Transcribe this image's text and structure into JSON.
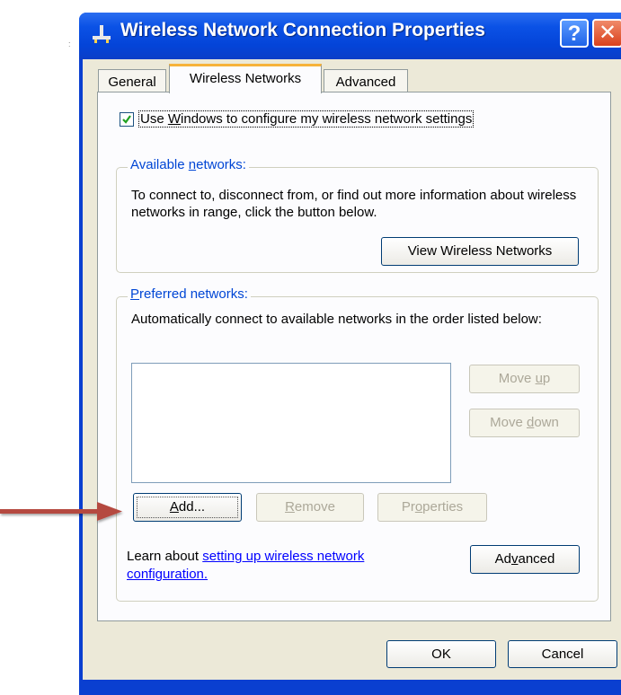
{
  "window": {
    "title": "Wireless Network Connection Properties",
    "help_label": "?",
    "close_label": "✕"
  },
  "tabs": [
    {
      "label": "General"
    },
    {
      "label": "Wireless Networks"
    },
    {
      "label": "Advanced"
    }
  ],
  "use_windows": {
    "label_pre": "Use ",
    "label_acc": "W",
    "label_post": "indows to configure my wireless network settings",
    "checked": true
  },
  "available": {
    "legend_pre": "Available ",
    "legend_acc": "n",
    "legend_post": "etworks:",
    "description": "To connect to, disconnect from, or find out more information about wireless networks in range, click the button below.",
    "view_button": "View Wireless Networks"
  },
  "preferred": {
    "legend_acc": "P",
    "legend_post": "referred networks:",
    "description": "Automatically connect to available networks in the order listed below:",
    "move_up_pre": "Move ",
    "move_up_acc": "u",
    "move_up_post": "p",
    "move_down_pre": "Move ",
    "move_down_acc": "d",
    "move_down_post": "own",
    "add_acc": "A",
    "add_post": "dd...",
    "remove_acc": "R",
    "remove_post": "emove",
    "properties_pre": "Pr",
    "properties_acc": "o",
    "properties_post": "perties",
    "learn_prefix": "Learn about ",
    "learn_link_line1": "setting up wireless network",
    "learn_link_line2": "configuration.",
    "advanced_pre": "Ad",
    "advanced_acc": "v",
    "advanced_post": "anced"
  },
  "footer": {
    "ok": "OK",
    "cancel": "Cancel"
  },
  "colors": {
    "titlebar": "#0a3ec8",
    "group_legend": "#0046d5",
    "arrow": "#b5493f",
    "tab_highlight": "#f6b33b"
  },
  "icons": [
    "network-icon",
    "help-icon",
    "close-icon",
    "checkmark-icon",
    "arrow-icon"
  ]
}
